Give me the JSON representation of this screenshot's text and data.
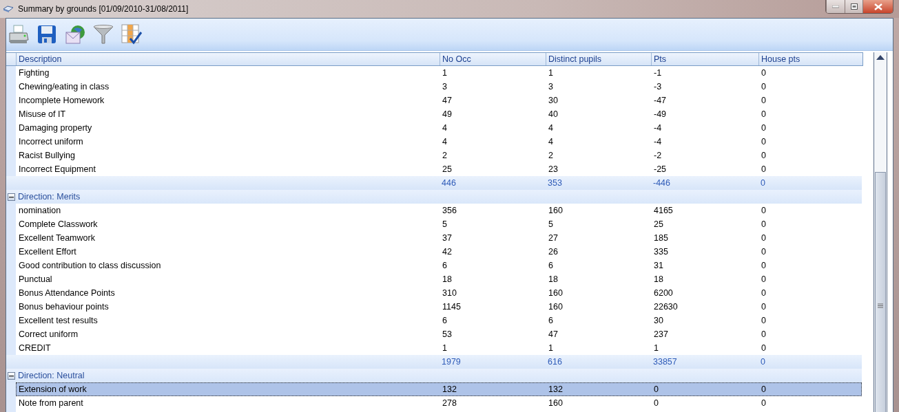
{
  "window": {
    "title": "Summary by grounds [01/09/2010-31/08/2011]"
  },
  "table": {
    "columns": [
      "Description",
      "No Occ",
      "Distinct pupils",
      "Pts",
      "House pts"
    ],
    "groups": [
      {
        "rows": [
          {
            "cells": [
              "Fighting",
              "1",
              "1",
              "-1",
              "0"
            ],
            "selected": false
          },
          {
            "cells": [
              "Chewing/eating in class",
              "3",
              "3",
              "-3",
              "0"
            ],
            "selected": false
          },
          {
            "cells": [
              "Incomplete Homework",
              "47",
              "30",
              "-47",
              "0"
            ],
            "selected": false
          },
          {
            "cells": [
              "Misuse of IT",
              "49",
              "40",
              "-49",
              "0"
            ],
            "selected": false
          },
          {
            "cells": [
              "Damaging property",
              "4",
              "4",
              "-4",
              "0"
            ],
            "selected": false
          },
          {
            "cells": [
              "Incorrect uniform",
              "4",
              "4",
              "-4",
              "0"
            ],
            "selected": false
          },
          {
            "cells": [
              "Racist Bullying",
              "2",
              "2",
              "-2",
              "0"
            ],
            "selected": false
          },
          {
            "cells": [
              "Incorrect Equipment",
              "25",
              "23",
              "-25",
              "0"
            ],
            "selected": false
          }
        ],
        "totals": [
          "446",
          "353",
          "-446",
          "0"
        ]
      },
      {
        "title": "Direction: Merits",
        "expanded": true,
        "rows": [
          {
            "cells": [
              "nomination",
              "356",
              "160",
              "4165",
              "0"
            ],
            "selected": false
          },
          {
            "cells": [
              "Complete Classwork",
              "5",
              "5",
              "25",
              "0"
            ],
            "selected": false
          },
          {
            "cells": [
              "Excellent Teamwork",
              "37",
              "27",
              "185",
              "0"
            ],
            "selected": false
          },
          {
            "cells": [
              "Excellent Effort",
              "42",
              "26",
              "335",
              "0"
            ],
            "selected": false
          },
          {
            "cells": [
              "Good contribution to class discussion",
              "6",
              "6",
              "31",
              "0"
            ],
            "selected": false
          },
          {
            "cells": [
              "Punctual",
              "18",
              "18",
              "18",
              "0"
            ],
            "selected": false
          },
          {
            "cells": [
              "Bonus Attendance Points",
              "310",
              "160",
              "6200",
              "0"
            ],
            "selected": false
          },
          {
            "cells": [
              "Bonus behaviour points",
              "1145",
              "160",
              "22630",
              "0"
            ],
            "selected": false
          },
          {
            "cells": [
              "Excellent test results",
              "6",
              "6",
              "30",
              "0"
            ],
            "selected": false
          },
          {
            "cells": [
              "Correct uniform",
              "53",
              "47",
              "237",
              "0"
            ],
            "selected": false
          },
          {
            "cells": [
              "CREDIT",
              "1",
              "1",
              "1",
              "0"
            ],
            "selected": false
          }
        ],
        "totals": [
          "1979",
          "616",
          "33857",
          "0"
        ]
      },
      {
        "title": "Direction: Neutral",
        "expanded": true,
        "rows": [
          {
            "cells": [
              "Extension of work",
              "132",
              "132",
              "0",
              "0"
            ],
            "selected": true
          },
          {
            "cells": [
              "Note from parent",
              "278",
              "160",
              "0",
              "0"
            ],
            "selected": false
          }
        ]
      }
    ]
  }
}
